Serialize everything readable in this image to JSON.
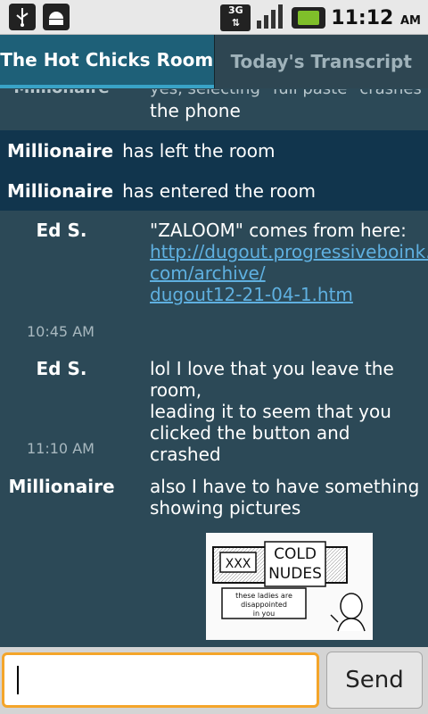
{
  "status_bar": {
    "time": "11:12",
    "ampm": "AM",
    "network": "3G",
    "icons": [
      "usb-icon",
      "android-debug-icon",
      "signal-icon",
      "battery-charging-icon"
    ]
  },
  "tabs": [
    {
      "label": "The Hot Chicks Room",
      "active": true
    },
    {
      "label": "Today's Transcript",
      "active": false
    }
  ],
  "chat": {
    "partial_top": {
      "name": "Millionaire",
      "text_hidden": "yes, selecting \"full paste\" crashes",
      "text": "the phone"
    },
    "events": [
      {
        "name": "Millionaire",
        "text": "has left the room"
      },
      {
        "name": "Millionaire",
        "text": "has entered the room"
      }
    ],
    "messages": [
      {
        "name": "Ed S.",
        "text": "\"ZALOOM\" comes from here:",
        "link": [
          "http://dugout.progressiveboink.",
          "com/archive/",
          "dugout12-21-04-1.htm"
        ]
      },
      {
        "timestamp": "10:45 AM"
      },
      {
        "name": "Ed S.",
        "lines": [
          "lol I love that you leave the room,",
          "leading it to seem that you",
          "clicked the button and crashed"
        ]
      },
      {
        "timestamp": "11:10 AM"
      },
      {
        "name": "Millionaire",
        "lines": [
          "also I have to have something",
          "showing pictures"
        ]
      }
    ],
    "image_caption": {
      "sign_left": "XXX",
      "sign_right_1": "COLD",
      "sign_right_2": "NUDES",
      "note_1": "these ladies are",
      "note_2": "disappointed",
      "note_3": "in you"
    }
  },
  "composer": {
    "input_value": "",
    "send_label": "Send"
  },
  "colors": {
    "background": "#2c4957",
    "event_band": "#11354d",
    "active_tab": "#1e6078",
    "link": "#5fb0e0",
    "input_focus": "#f4a52a"
  }
}
